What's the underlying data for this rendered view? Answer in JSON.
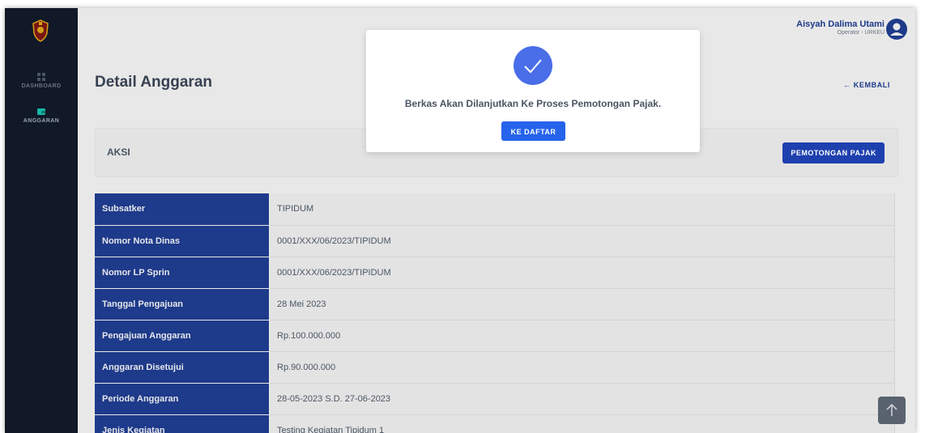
{
  "sidebar": {
    "items": [
      {
        "label": "DASHBOARD",
        "icon": "grid-icon"
      },
      {
        "label": "ANGGARAN",
        "icon": "wallet-icon"
      }
    ]
  },
  "header": {
    "user_name": "Aisyah Dalima Utami",
    "user_role": "Operator - URKEU"
  },
  "page": {
    "title": "Detail Anggaran",
    "back_label": "← KEMBALI"
  },
  "aksi": {
    "label": "AKSI",
    "button_label": "PEMOTONGAN PAJAK"
  },
  "details": [
    {
      "label": "Subsatker",
      "value": "TIPIDUM"
    },
    {
      "label": "Nomor Nota Dinas",
      "value": "0001/XXX/06/2023/TIPIDUM"
    },
    {
      "label": "Nomor LP Sprin",
      "value": "0001/XXX/06/2023/TIPIDUM"
    },
    {
      "label": "Tanggal Pengajuan",
      "value": "28 Mei 2023"
    },
    {
      "label": "Pengajuan Anggaran",
      "value": "Rp.100.000.000"
    },
    {
      "label": "Anggaran Disetujui",
      "value": "Rp.90.000.000"
    },
    {
      "label": "Periode Anggaran",
      "value": "28-05-2023 S.D. 27-06-2023"
    },
    {
      "label": "Jenis Kegiatan",
      "value": "Testing Kegiatan Tipidum 1"
    }
  ],
  "modal": {
    "message": "Berkas Akan Dilanjutkan Ke Proses Pemotongan Pajak.",
    "button_label": "KE DAFTAR",
    "icon": "check-circle-icon"
  },
  "colors": {
    "sidebar": "#111827",
    "primary": "#1e3a8a",
    "button": "#1e40af",
    "modal_button": "#2563eb",
    "check": "#3b6fe0"
  }
}
